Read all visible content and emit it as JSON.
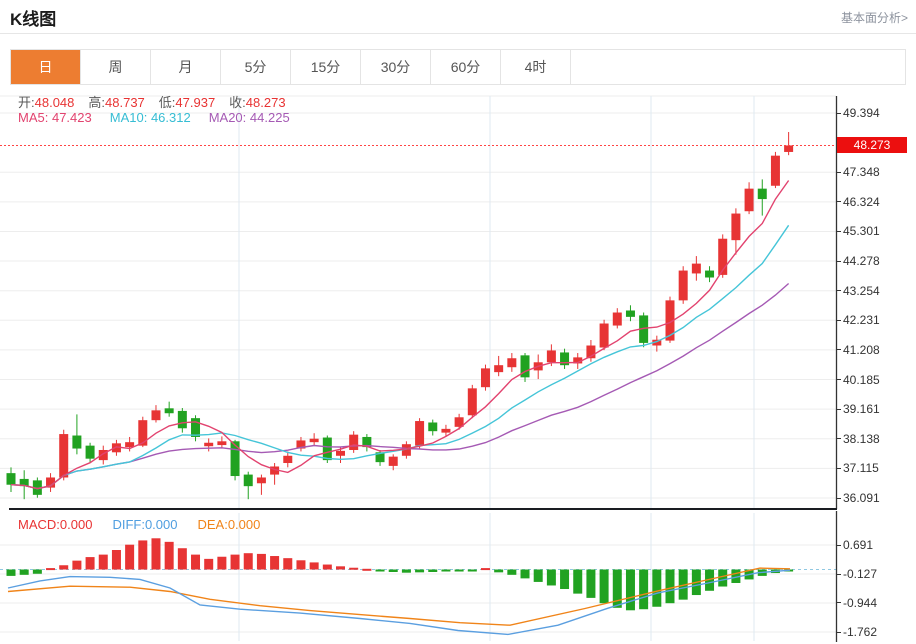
{
  "header": {
    "title": "K线图",
    "link_label": "基本面分析>"
  },
  "tabs": {
    "items": [
      "日",
      "周",
      "月",
      "5分",
      "15分",
      "30分",
      "60分",
      "4时"
    ],
    "active_index": 0
  },
  "info": {
    "open_label": "开:",
    "open_value": "48.048",
    "high_label": "高:",
    "high_value": "48.737",
    "low_label": "低:",
    "low_value": "47.937",
    "close_label": "收:",
    "close_value": "48.273",
    "ma5_label": "MA5:",
    "ma5_value": "47.423",
    "ma10_label": "MA10:",
    "ma10_value": "46.312",
    "ma20_label": "MA20:",
    "ma20_value": "44.225"
  },
  "macd_info": {
    "macd_label": "MACD:",
    "macd_value": "0.000",
    "diff_label": "DIFF:",
    "diff_value": "0.000",
    "dea_label": "DEA:",
    "dea_value": "0.000"
  },
  "price_tag": "48.273",
  "colors": {
    "up": "#e73434",
    "down": "#21a221",
    "ma5": "#e2436f",
    "ma10": "#45c5d8",
    "ma20": "#a55ab4",
    "diff": "#5b9fe0",
    "dea": "#f08419",
    "tag_bg": "#ec0f0f",
    "price_line": "#ff4444",
    "tab_active_bg": "#ed7d31",
    "grid": "#ededed",
    "vgrid": "#dfe9f1",
    "zero_line": "#8fc8e2",
    "axis": "#333333"
  },
  "chart_data": {
    "type": "candlestick+macd",
    "main": {
      "type": "candlestick",
      "title": "K线图 日K",
      "ylim": [
        36.091,
        49.394
      ],
      "y_axis": [
        49.394,
        47.348,
        46.324,
        45.301,
        44.278,
        43.254,
        42.231,
        41.208,
        40.185,
        39.161,
        38.138,
        37.115,
        36.091
      ],
      "current_price": 48.273,
      "ma_periods": [
        5,
        10,
        20
      ],
      "candles_format": [
        "open",
        "close",
        "low",
        "high"
      ],
      "candles": [
        [
          36.95,
          36.55,
          36.3,
          37.15
        ],
        [
          36.75,
          36.5,
          36.05,
          37.05
        ],
        [
          36.7,
          36.2,
          36.1,
          36.8
        ],
        [
          36.45,
          36.8,
          36.3,
          36.95
        ],
        [
          36.8,
          38.3,
          36.7,
          38.45
        ],
        [
          38.25,
          37.8,
          37.6,
          38.98
        ],
        [
          37.9,
          37.45,
          37.3,
          38.0
        ],
        [
          37.4,
          37.75,
          37.25,
          37.9
        ],
        [
          37.67,
          37.98,
          37.55,
          38.1
        ],
        [
          37.85,
          38.02,
          37.7,
          38.2
        ],
        [
          37.9,
          38.78,
          37.85,
          38.9
        ],
        [
          38.78,
          39.12,
          38.7,
          39.3
        ],
        [
          39.19,
          39.02,
          38.9,
          39.42
        ],
        [
          39.1,
          38.5,
          38.35,
          39.2
        ],
        [
          38.85,
          38.2,
          38.05,
          38.95
        ],
        [
          37.88,
          38.0,
          37.7,
          38.15
        ],
        [
          37.92,
          38.05,
          37.8,
          38.22
        ],
        [
          38.05,
          36.85,
          36.7,
          38.1
        ],
        [
          36.9,
          36.5,
          36.05,
          37.0
        ],
        [
          36.6,
          36.8,
          36.2,
          36.9
        ],
        [
          36.9,
          37.18,
          36.55,
          37.3
        ],
        [
          37.3,
          37.55,
          37.15,
          37.7
        ],
        [
          37.8,
          38.08,
          37.7,
          38.2
        ],
        [
          38.02,
          38.14,
          37.9,
          38.33
        ],
        [
          38.18,
          37.4,
          37.3,
          38.25
        ],
        [
          37.55,
          37.72,
          37.3,
          37.85
        ],
        [
          37.75,
          38.28,
          37.65,
          38.4
        ],
        [
          38.2,
          37.85,
          37.7,
          38.3
        ],
        [
          37.67,
          37.33,
          37.2,
          37.75
        ],
        [
          37.2,
          37.52,
          37.05,
          37.6
        ],
        [
          37.55,
          37.95,
          37.45,
          38.05
        ],
        [
          37.9,
          38.75,
          37.8,
          38.85
        ],
        [
          38.7,
          38.4,
          38.25,
          38.8
        ],
        [
          38.35,
          38.48,
          38.2,
          38.62
        ],
        [
          38.55,
          38.88,
          38.45,
          39.0
        ],
        [
          38.95,
          39.88,
          38.85,
          40.0
        ],
        [
          39.92,
          40.57,
          39.8,
          40.7
        ],
        [
          40.44,
          40.68,
          40.3,
          41.0
        ],
        [
          40.61,
          40.92,
          40.45,
          41.1
        ],
        [
          41.02,
          40.26,
          40.1,
          41.1
        ],
        [
          40.5,
          40.78,
          40.2,
          41.05
        ],
        [
          40.78,
          41.19,
          40.65,
          41.4
        ],
        [
          41.12,
          40.68,
          40.55,
          41.25
        ],
        [
          40.74,
          40.95,
          40.55,
          41.1
        ],
        [
          40.92,
          41.36,
          40.8,
          41.55
        ],
        [
          41.29,
          42.12,
          41.2,
          42.25
        ],
        [
          42.05,
          42.5,
          41.95,
          42.65
        ],
        [
          42.57,
          42.35,
          42.2,
          42.75
        ],
        [
          42.4,
          41.45,
          41.3,
          42.5
        ],
        [
          41.36,
          41.56,
          41.15,
          41.7
        ],
        [
          41.53,
          42.92,
          41.45,
          43.05
        ],
        [
          42.92,
          43.95,
          42.8,
          44.1
        ],
        [
          43.85,
          44.19,
          43.6,
          44.45
        ],
        [
          43.95,
          43.71,
          43.55,
          44.1
        ],
        [
          43.8,
          45.05,
          43.7,
          45.2
        ],
        [
          45.0,
          45.92,
          44.5,
          46.1
        ],
        [
          46.0,
          46.78,
          45.9,
          47.0
        ],
        [
          46.78,
          46.42,
          45.85,
          47.1
        ],
        [
          46.88,
          47.92,
          46.8,
          48.05
        ],
        [
          48.048,
          48.273,
          47.937,
          48.737
        ]
      ]
    },
    "macd": {
      "type": "bar+lines",
      "ylim": [
        -1.762,
        0.691
      ],
      "y_axis": [
        0.691,
        -0.127,
        -0.944,
        -1.762
      ],
      "histogram": [
        -0.18,
        -0.15,
        -0.12,
        0.04,
        0.12,
        0.25,
        0.35,
        0.42,
        0.55,
        0.7,
        0.82,
        0.88,
        0.78,
        0.6,
        0.42,
        0.3,
        0.36,
        0.42,
        0.46,
        0.44,
        0.38,
        0.32,
        0.26,
        0.2,
        0.14,
        0.09,
        0.05,
        0.02,
        -0.04,
        -0.07,
        -0.09,
        -0.08,
        -0.07,
        -0.05,
        -0.03,
        -0.04,
        0.04,
        -0.08,
        -0.15,
        -0.25,
        -0.35,
        -0.45,
        -0.55,
        -0.68,
        -0.8,
        -0.95,
        -1.08,
        -1.15,
        -1.12,
        -1.05,
        -0.95,
        -0.85,
        -0.72,
        -0.6,
        -0.48,
        -0.38,
        -0.28,
        -0.18,
        -0.1,
        -0.03
      ],
      "diff_line": [
        [
          8,
          -0.52
        ],
        [
          40,
          -0.32
        ],
        [
          70,
          -0.2
        ],
        [
          110,
          -0.22
        ],
        [
          140,
          -0.28
        ],
        [
          170,
          -0.52
        ],
        [
          200,
          -1.0
        ],
        [
          240,
          -1.12
        ],
        [
          300,
          -1.23
        ],
        [
          360,
          -1.38
        ],
        [
          410,
          -1.52
        ],
        [
          458,
          -1.72
        ],
        [
          508,
          -1.83
        ],
        [
          558,
          -1.57
        ],
        [
          608,
          -1.09
        ],
        [
          658,
          -0.66
        ],
        [
          708,
          -0.38
        ],
        [
          758,
          -0.09
        ],
        [
          790,
          -0.02
        ]
      ],
      "dea_line": [
        [
          8,
          -0.62
        ],
        [
          70,
          -0.47
        ],
        [
          130,
          -0.5
        ],
        [
          170,
          -0.62
        ],
        [
          210,
          -0.84
        ],
        [
          260,
          -1.02
        ],
        [
          310,
          -1.16
        ],
        [
          360,
          -1.27
        ],
        [
          410,
          -1.38
        ],
        [
          460,
          -1.5
        ],
        [
          510,
          -1.57
        ],
        [
          585,
          -1.1
        ],
        [
          660,
          -0.59
        ],
        [
          720,
          -0.21
        ],
        [
          760,
          0.04
        ],
        [
          790,
          0.02
        ]
      ]
    }
  }
}
